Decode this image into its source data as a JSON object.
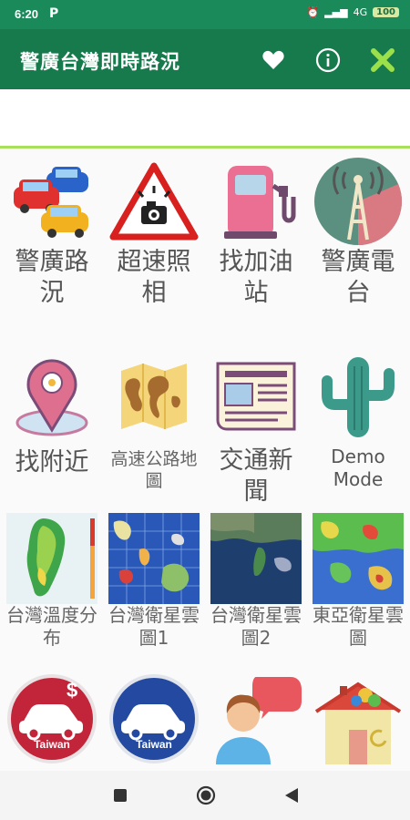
{
  "status": {
    "time": "6:20",
    "p": "P",
    "net": "4G",
    "battery": "100"
  },
  "appbar": {
    "title": "警廣台灣即時路況"
  },
  "grid": {
    "items": [
      {
        "label": "警廣路況"
      },
      {
        "label": "超速照相"
      },
      {
        "label": "找加油站"
      },
      {
        "label": "警廣電台"
      },
      {
        "label": "找附近"
      },
      {
        "label": "高速公路地圖"
      },
      {
        "label": "交通新聞"
      },
      {
        "label": "Demo Mode"
      },
      {
        "label": "台灣溫度分布"
      },
      {
        "label": "台灣衛星雲圖1"
      },
      {
        "label": "台灣衛星雲圖2"
      },
      {
        "label": "東亞衛星雲圖"
      },
      {
        "label": "Taiwan"
      },
      {
        "label": "Taiwan"
      }
    ]
  }
}
